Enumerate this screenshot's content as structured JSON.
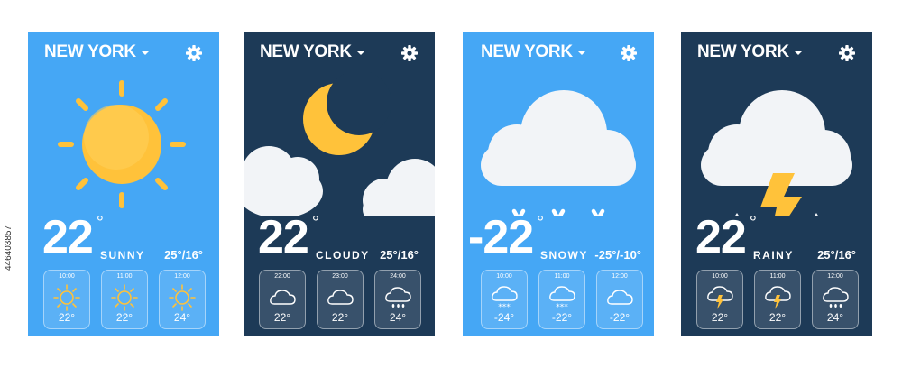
{
  "cards": [
    {
      "theme": "light",
      "city": "NEW YORK",
      "weather_icon": "sun-icon",
      "temp": "22",
      "deg": "°",
      "condition": "SUNNY",
      "range": "25°/16°",
      "hours": [
        {
          "time": "10:00",
          "icon": "sun-icon",
          "temp": "22°"
        },
        {
          "time": "11:00",
          "icon": "sun-icon",
          "temp": "22°"
        },
        {
          "time": "12:00",
          "icon": "sun-icon",
          "temp": "24°"
        }
      ]
    },
    {
      "theme": "dark",
      "city": "NEW YORK",
      "weather_icon": "moon-cloud-icon",
      "temp": "22",
      "deg": "°",
      "condition": "CLOUDY",
      "range": "25°/16°",
      "hours": [
        {
          "time": "22:00",
          "icon": "cloud-icon",
          "temp": "22°"
        },
        {
          "time": "23:00",
          "icon": "cloud-icon",
          "temp": "22°"
        },
        {
          "time": "24:00",
          "icon": "rain-cloud-icon",
          "temp": "24°"
        }
      ]
    },
    {
      "theme": "light",
      "city": "NEW YORK",
      "weather_icon": "snow-cloud-icon",
      "temp": "-22",
      "deg": "°",
      "condition": "SNOWY",
      "range": "-25°/-10°",
      "hours": [
        {
          "time": "10:00",
          "icon": "snow-cloud-icon",
          "temp": "-24°"
        },
        {
          "time": "11:00",
          "icon": "snow-cloud-icon",
          "temp": "-22°"
        },
        {
          "time": "12:00",
          "icon": "cloud-icon",
          "temp": "-22°"
        }
      ]
    },
    {
      "theme": "dark",
      "city": "NEW YORK",
      "weather_icon": "storm-cloud-icon",
      "temp": "22",
      "deg": "°",
      "condition": "RAINY",
      "range": "25°/16°",
      "hours": [
        {
          "time": "10:00",
          "icon": "storm-cloud-icon",
          "temp": "22°"
        },
        {
          "time": "11:00",
          "icon": "storm-cloud-icon",
          "temp": "22°"
        },
        {
          "time": "12:00",
          "icon": "rain-cloud-icon",
          "temp": "24°"
        }
      ]
    }
  ],
  "watermark": "446403857",
  "colors": {
    "light_bg": "#45a7f5",
    "dark_bg": "#1d3a57",
    "sun": "#ffc23a",
    "cloud": "#ffffff"
  }
}
